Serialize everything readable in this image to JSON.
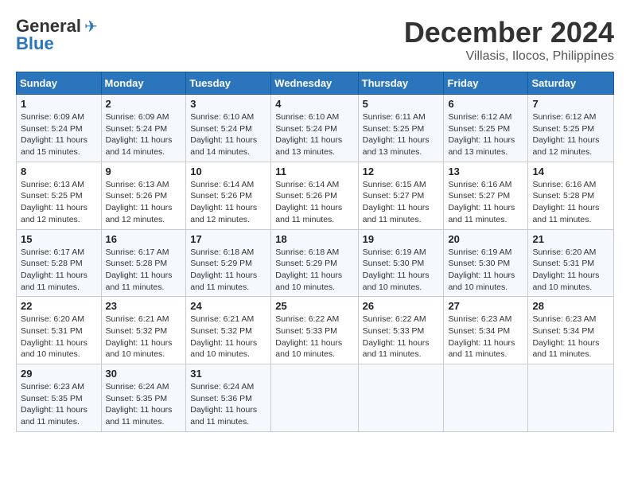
{
  "header": {
    "logo_general": "General",
    "logo_blue": "Blue",
    "month_title": "December 2024",
    "location": "Villasis, Ilocos, Philippines"
  },
  "weekdays": [
    "Sunday",
    "Monday",
    "Tuesday",
    "Wednesday",
    "Thursday",
    "Friday",
    "Saturday"
  ],
  "weeks": [
    [
      {
        "day": "1",
        "sunrise": "6:09 AM",
        "sunset": "5:24 PM",
        "daylight": "11 hours and 15 minutes."
      },
      {
        "day": "2",
        "sunrise": "6:09 AM",
        "sunset": "5:24 PM",
        "daylight": "11 hours and 14 minutes."
      },
      {
        "day": "3",
        "sunrise": "6:10 AM",
        "sunset": "5:24 PM",
        "daylight": "11 hours and 14 minutes."
      },
      {
        "day": "4",
        "sunrise": "6:10 AM",
        "sunset": "5:24 PM",
        "daylight": "11 hours and 13 minutes."
      },
      {
        "day": "5",
        "sunrise": "6:11 AM",
        "sunset": "5:25 PM",
        "daylight": "11 hours and 13 minutes."
      },
      {
        "day": "6",
        "sunrise": "6:12 AM",
        "sunset": "5:25 PM",
        "daylight": "11 hours and 13 minutes."
      },
      {
        "day": "7",
        "sunrise": "6:12 AM",
        "sunset": "5:25 PM",
        "daylight": "11 hours and 12 minutes."
      }
    ],
    [
      {
        "day": "8",
        "sunrise": "6:13 AM",
        "sunset": "5:25 PM",
        "daylight": "11 hours and 12 minutes."
      },
      {
        "day": "9",
        "sunrise": "6:13 AM",
        "sunset": "5:26 PM",
        "daylight": "11 hours and 12 minutes."
      },
      {
        "day": "10",
        "sunrise": "6:14 AM",
        "sunset": "5:26 PM",
        "daylight": "11 hours and 12 minutes."
      },
      {
        "day": "11",
        "sunrise": "6:14 AM",
        "sunset": "5:26 PM",
        "daylight": "11 hours and 11 minutes."
      },
      {
        "day": "12",
        "sunrise": "6:15 AM",
        "sunset": "5:27 PM",
        "daylight": "11 hours and 11 minutes."
      },
      {
        "day": "13",
        "sunrise": "6:16 AM",
        "sunset": "5:27 PM",
        "daylight": "11 hours and 11 minutes."
      },
      {
        "day": "14",
        "sunrise": "6:16 AM",
        "sunset": "5:28 PM",
        "daylight": "11 hours and 11 minutes."
      }
    ],
    [
      {
        "day": "15",
        "sunrise": "6:17 AM",
        "sunset": "5:28 PM",
        "daylight": "11 hours and 11 minutes."
      },
      {
        "day": "16",
        "sunrise": "6:17 AM",
        "sunset": "5:28 PM",
        "daylight": "11 hours and 11 minutes."
      },
      {
        "day": "17",
        "sunrise": "6:18 AM",
        "sunset": "5:29 PM",
        "daylight": "11 hours and 11 minutes."
      },
      {
        "day": "18",
        "sunrise": "6:18 AM",
        "sunset": "5:29 PM",
        "daylight": "11 hours and 10 minutes."
      },
      {
        "day": "19",
        "sunrise": "6:19 AM",
        "sunset": "5:30 PM",
        "daylight": "11 hours and 10 minutes."
      },
      {
        "day": "20",
        "sunrise": "6:19 AM",
        "sunset": "5:30 PM",
        "daylight": "11 hours and 10 minutes."
      },
      {
        "day": "21",
        "sunrise": "6:20 AM",
        "sunset": "5:31 PM",
        "daylight": "11 hours and 10 minutes."
      }
    ],
    [
      {
        "day": "22",
        "sunrise": "6:20 AM",
        "sunset": "5:31 PM",
        "daylight": "11 hours and 10 minutes."
      },
      {
        "day": "23",
        "sunrise": "6:21 AM",
        "sunset": "5:32 PM",
        "daylight": "11 hours and 10 minutes."
      },
      {
        "day": "24",
        "sunrise": "6:21 AM",
        "sunset": "5:32 PM",
        "daylight": "11 hours and 10 minutes."
      },
      {
        "day": "25",
        "sunrise": "6:22 AM",
        "sunset": "5:33 PM",
        "daylight": "11 hours and 10 minutes."
      },
      {
        "day": "26",
        "sunrise": "6:22 AM",
        "sunset": "5:33 PM",
        "daylight": "11 hours and 11 minutes."
      },
      {
        "day": "27",
        "sunrise": "6:23 AM",
        "sunset": "5:34 PM",
        "daylight": "11 hours and 11 minutes."
      },
      {
        "day": "28",
        "sunrise": "6:23 AM",
        "sunset": "5:34 PM",
        "daylight": "11 hours and 11 minutes."
      }
    ],
    [
      {
        "day": "29",
        "sunrise": "6:23 AM",
        "sunset": "5:35 PM",
        "daylight": "11 hours and 11 minutes."
      },
      {
        "day": "30",
        "sunrise": "6:24 AM",
        "sunset": "5:35 PM",
        "daylight": "11 hours and 11 minutes."
      },
      {
        "day": "31",
        "sunrise": "6:24 AM",
        "sunset": "5:36 PM",
        "daylight": "11 hours and 11 minutes."
      },
      null,
      null,
      null,
      null
    ]
  ]
}
